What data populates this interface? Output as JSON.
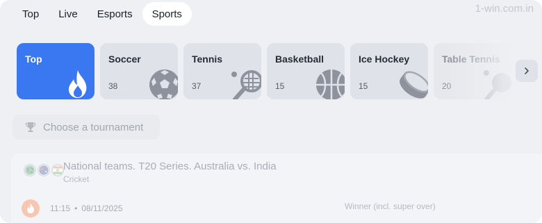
{
  "nav": {
    "tabs": [
      {
        "label": "Top"
      },
      {
        "label": "Live"
      },
      {
        "label": "Esports"
      },
      {
        "label": "Sports",
        "active": true
      }
    ]
  },
  "watermark": "1-win.com.in",
  "sports": [
    {
      "label": "Top",
      "icon": "fire-icon",
      "active": true
    },
    {
      "label": "Soccer",
      "count": "38",
      "icon": "soccer-ball-icon"
    },
    {
      "label": "Tennis",
      "count": "37",
      "icon": "tennis-racket-icon"
    },
    {
      "label": "Basketball",
      "count": "15",
      "icon": "basketball-icon"
    },
    {
      "label": "Ice Hockey",
      "count": "15",
      "icon": "hockey-puck-icon"
    },
    {
      "label": "Table Tennis",
      "count": "20",
      "icon": "ping-pong-icon"
    }
  ],
  "tournament": {
    "placeholder": "Choose a tournament",
    "icon": "trophy-icon"
  },
  "match": {
    "title": "National teams. T20 Series. Australia vs. India",
    "sport": "Cricket",
    "time": "11:15",
    "separator": "•",
    "date": "08/11/2025",
    "market": "Winner (incl. super over)"
  },
  "colors": {
    "accent": "#3a78f2",
    "background": "#eef0f4",
    "card": "#dfe2e8",
    "fire_badge": "#f6c7b3"
  }
}
